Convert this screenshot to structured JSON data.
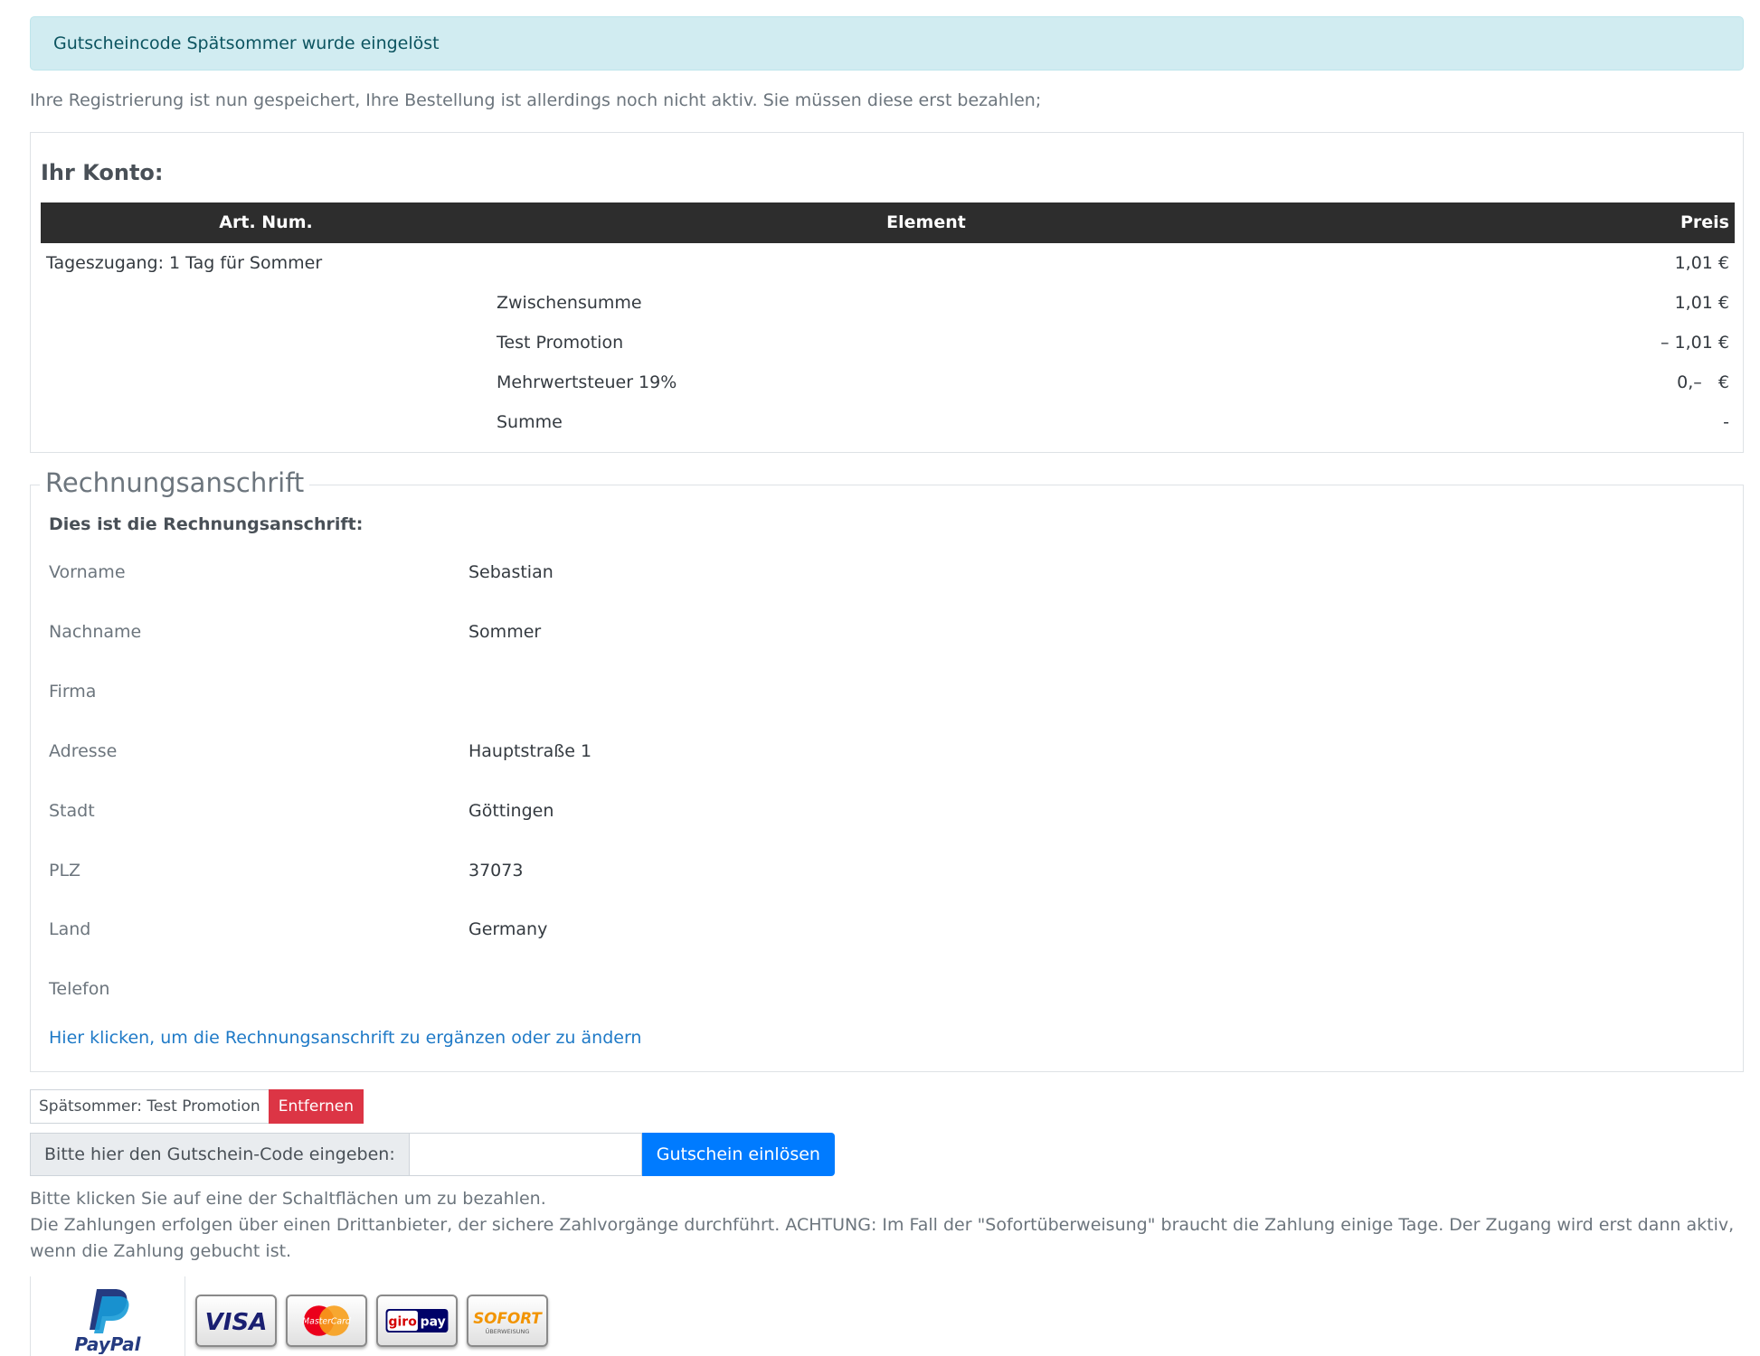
{
  "alert": {
    "text": "Gutscheincode Spätsommer wurde eingelöst"
  },
  "intro": "Ihre Registrierung ist nun gespeichert, Ihre Bestellung ist allerdings noch nicht aktiv. Sie müssen diese erst bezahlen;",
  "account": {
    "title": "Ihr Konto:",
    "headers": {
      "art_num": "Art. Num.",
      "element": "Element",
      "price": "Preis"
    },
    "rows": [
      {
        "label": "Tageszugang: 1 Tag für Sommer",
        "value": "1,01 €"
      },
      {
        "label": "Zwischensumme",
        "value": "1,01 €"
      },
      {
        "label": "Test Promotion",
        "value": "– 1,01 €"
      },
      {
        "label": "Mehrwertsteuer 19%",
        "value": "0,–   €"
      },
      {
        "label": "Summe",
        "value": "-"
      }
    ]
  },
  "billing": {
    "legend": "Rechnungsanschrift",
    "subtitle": "Dies ist die Rechnungsanschrift:",
    "fields": [
      {
        "label": "Vorname",
        "value": "Sebastian"
      },
      {
        "label": "Nachname",
        "value": "Sommer"
      },
      {
        "label": "Firma",
        "value": ""
      },
      {
        "label": "Adresse",
        "value": "Hauptstraße 1"
      },
      {
        "label": "Stadt",
        "value": "Göttingen"
      },
      {
        "label": "PLZ",
        "value": "37073"
      },
      {
        "label": "Land",
        "value": "Germany"
      },
      {
        "label": "Telefon",
        "value": ""
      }
    ],
    "edit_link": "Hier klicken, um die Rechnungsanschrift zu ergänzen oder zu ändern"
  },
  "promo": {
    "name": "Spätsommer: Test Promotion",
    "remove_label": "Entfernen"
  },
  "voucher": {
    "label": "Bitte hier den Gutschein-Code eingeben:",
    "value": "",
    "button": "Gutschein einlösen"
  },
  "payment": {
    "line1": "Bitte klicken Sie auf eine der Schaltflächen um zu bezahlen.",
    "line2": "Die Zahlungen erfolgen über einen Drittanbieter, der sichere Zahlvorgänge durchführt. ACHTUNG: Im Fall der \"Sofortüberweisung\" braucht die Zahlung einige Tage. Der Zugang wird erst dann aktiv, wenn die Zahlung gebucht ist.",
    "methods": {
      "paypal": "PayPal",
      "visa": "VISA",
      "mastercard": "MasterCard",
      "giropay_a": "giro",
      "giropay_b": "pay",
      "sofort": "SOFORT",
      "sofort_sub": "ÜBERWEISUNG"
    }
  },
  "colors": {
    "alert_bg": "#d1ecf1",
    "danger": "#dc3545",
    "primary": "#007bff",
    "table_head": "#2d2d2d",
    "link": "#1f7ac7"
  }
}
